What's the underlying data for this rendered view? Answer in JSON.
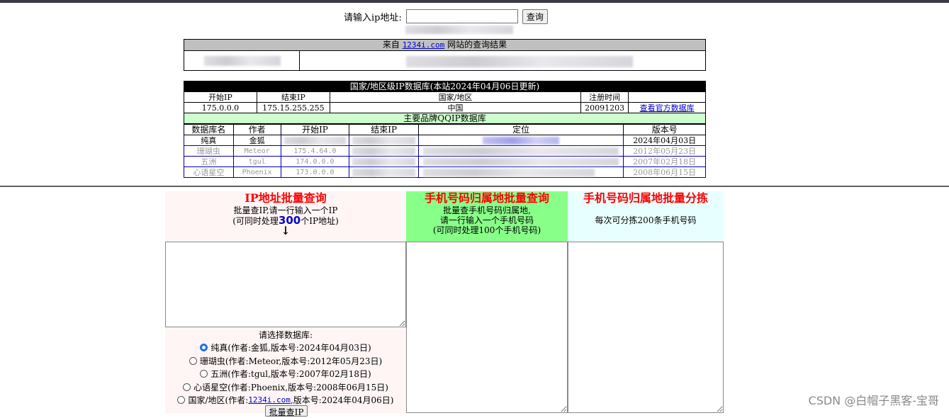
{
  "search": {
    "label": "请输入ip地址:",
    "value": "",
    "button": "查询"
  },
  "result": {
    "prefix": "来自",
    "site": "1234i.com",
    "suffix": "网站的查询结果"
  },
  "country_table": {
    "title": "国家/地区级IP数据库(本站2024年04月06日更新)",
    "headers": [
      "开始IP",
      "结束IP",
      "国家/地区",
      "注册时间",
      ""
    ],
    "row": [
      "175.0.0.0",
      "175.15.255.255",
      "中国",
      "20091203",
      "查看官方数据库"
    ],
    "brand_title": "主要品牌QQIP数据库"
  },
  "brand_table": {
    "headers": [
      "数据库名",
      "作者",
      "开始IP",
      "结束IP",
      "定位",
      "版本号"
    ],
    "rows": [
      {
        "name": "纯真",
        "author": "金狐",
        "start": "",
        "version": "2024年04月03日"
      },
      {
        "name": "珊瑚虫",
        "author": "Meteor",
        "start": "175.4.64.0",
        "version": "2012年05月23日"
      },
      {
        "name": "五洲",
        "author": "tgul",
        "start": "174.0.0.0",
        "version": "2007年02月18日"
      },
      {
        "name": "心语星空",
        "author": "Phoenix",
        "start": "173.0.0.0",
        "version": "2008年06月15日"
      }
    ]
  },
  "panel_ip": {
    "title": "IP地址批量查询",
    "desc1": "批量查IP,请一行输入一个IP",
    "desc2_pre": "(可同时处理",
    "desc2_num": "300",
    "desc2_post": "个IP地址)",
    "arrow": "↓"
  },
  "panel_phone": {
    "title": "手机号码归属地批量查询",
    "desc1": "批量查手机号码归属地,",
    "desc2": "请一行输入一个手机号码",
    "desc3": "(可同时处理100个手机号码)"
  },
  "panel_sort": {
    "title": "手机号码归属地批量分拣",
    "desc": "每次可分拣200条手机号码"
  },
  "db_select": {
    "label": "请选择数据库:",
    "options": [
      {
        "text": "纯真(作者:金狐,版本号:2024年04月03日)",
        "checked": true
      },
      {
        "text": "珊瑚虫(作者:Meteor,版本号:2012年05月23日)",
        "checked": false
      },
      {
        "text": "五洲(作者:tgul,版本号:2007年02月18日)",
        "checked": false
      },
      {
        "text": "心语星空(作者:Phoenix,版本号:2008年06月15日)",
        "checked": false
      }
    ],
    "last_pre": "国家/地区(作者:",
    "last_link": "1234i.com",
    "last_post": ",版本号:2024年04月06日)",
    "button": "批量查IP"
  },
  "watermark": "CSDN @白帽子黑客-宝哥"
}
